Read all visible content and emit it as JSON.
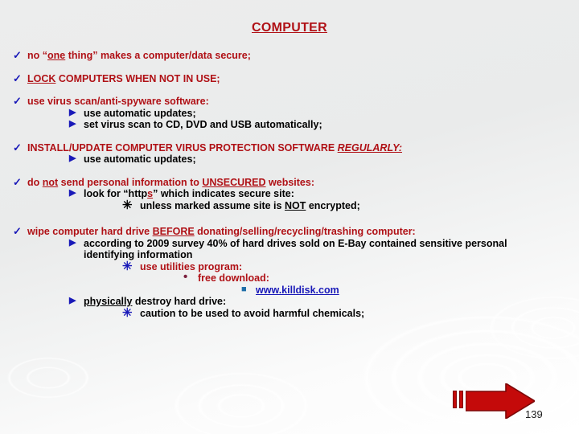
{
  "slide": {
    "title": "COMPUTER",
    "page_number": "139",
    "accent_red": "#b01116",
    "accent_blue": "#1919b8",
    "link_blue": "#1919b8",
    "arrow_red": "#c40a0a",
    "background": "#eceded"
  },
  "markers": {
    "check": "✓",
    "triangle": "▶",
    "star": "✳",
    "dot": "•",
    "square": "■"
  },
  "bullets": {
    "b1_pre": "no “",
    "b1_u": "one",
    "b1_post": " thing” makes a computer/data secure;",
    "b2_u": "LOCK",
    "b2_post": " COMPUTERS WHEN NOT IN USE;",
    "b3": "use virus scan/anti-spyware software:",
    "b3_s1": "use automatic updates;",
    "b3_s2": "set virus scan to CD, DVD and USB automatically;",
    "b4_pre": "INSTALL/UPDATE COMPUTER VIRUS PROTECTION SOFTWARE ",
    "b4_ui": "REGULARLY:",
    "b4_s1": "use automatic updates;",
    "b5_pre": "do ",
    "b5_u1": "not",
    "b5_mid": " send personal information to ",
    "b5_u2": "UNSECURED",
    "b5_post": " websites:",
    "b5_s1_pre": "look for “http",
    "b5_s1_s": "s",
    "b5_s1_post": "” which indicates secure site:",
    "b5_s2_pre": "unless marked assume site is ",
    "b5_s2_u": "NOT",
    "b5_s2_post": " encrypted;",
    "b6_pre": "wipe computer hard drive ",
    "b6_u": "BEFORE",
    "b6_post": " donating/selling/recycling/trashing computer:",
    "b6_s1_l1": "according to 2009 survey 40% of hard drives sold on E-Bay contained sensitive personal",
    "b6_s1_l2": "identifying information",
    "b6_s2": "use utilities program:",
    "b6_s3": "free download:",
    "b6_s4_link": "www.killdisk.com",
    "b6_s5_u": "physically",
    "b6_s5_post": " destroy hard drive:",
    "b6_s6": "caution to be used to avoid harmful chemicals;"
  }
}
